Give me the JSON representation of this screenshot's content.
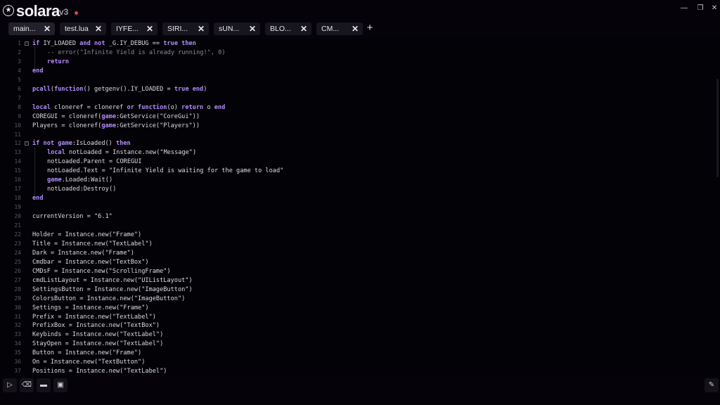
{
  "app": {
    "name": "solara",
    "version": "v3"
  },
  "window_controls": {
    "minimize": "—",
    "maximize": "❐",
    "close": "✕"
  },
  "tabs": [
    {
      "label": "main...",
      "active": true
    },
    {
      "label": "test.lua",
      "active": false
    },
    {
      "label": "IYFE...",
      "active": false
    },
    {
      "label": "SIRI...",
      "active": false
    },
    {
      "label": "sUN...",
      "active": false
    },
    {
      "label": "BLO...",
      "active": false
    },
    {
      "label": "CM...",
      "active": false
    }
  ],
  "tab_add": "+",
  "tab_close": "✕",
  "code": [
    {
      "n": "1",
      "fold": true,
      "indent": 0,
      "t": "<span class=\"kw\">if</span> IY_LOADED <span class=\"kw\">and not</span> _G.IY_DEBUG == <span class=\"kw\">true then</span>"
    },
    {
      "n": "2",
      "indent": 1,
      "t": "<span class=\"com\">-- error(\"Infinite Yield is already running!\", 0)</span>"
    },
    {
      "n": "3",
      "indent": 1,
      "t": "<span class=\"kw\">return</span>"
    },
    {
      "n": "4",
      "indent": 0,
      "t": "<span class=\"kw\">end</span>"
    },
    {
      "n": "5",
      "indent": 0,
      "t": ""
    },
    {
      "n": "6",
      "indent": 0,
      "t": "<span class=\"kw\">pcall</span>(<span class=\"kw\">function</span>() getgenv().IY_LOADED = <span class=\"kw\">true end</span>)"
    },
    {
      "n": "7",
      "indent": 0,
      "t": ""
    },
    {
      "n": "8",
      "indent": 0,
      "t": "<span class=\"kw\">local</span> cloneref = cloneref <span class=\"kw\">or function</span>(o) <span class=\"kw\">return</span> o <span class=\"kw\">end</span>"
    },
    {
      "n": "9",
      "indent": 0,
      "t": "COREGUI = cloneref(<span class=\"kw\">game</span>:GetService(\"CoreGui\"))"
    },
    {
      "n": "10",
      "indent": 0,
      "t": "Players = cloneref(<span class=\"kw\">game</span>:GetService(\"Players\"))"
    },
    {
      "n": "11",
      "indent": 0,
      "t": ""
    },
    {
      "n": "12",
      "fold": true,
      "indent": 0,
      "t": "<span class=\"kw\">if not game</span>:IsLoaded() <span class=\"kw\">then</span>"
    },
    {
      "n": "13",
      "indent": 1,
      "t": "<span class=\"kw\">local</span> notLoaded = Instance.new(\"Message\")"
    },
    {
      "n": "14",
      "indent": 1,
      "t": "notLoaded.Parent = COREGUI"
    },
    {
      "n": "15",
      "indent": 1,
      "t": "notLoaded.Text = \"Infinite Yield is waiting for the game to load\""
    },
    {
      "n": "16",
      "indent": 1,
      "t": "<span class=\"kw\">game</span>.Loaded:Wait()"
    },
    {
      "n": "17",
      "indent": 1,
      "t": "notLoaded:Destroy()"
    },
    {
      "n": "18",
      "indent": 0,
      "t": "<span class=\"kw\">end</span>"
    },
    {
      "n": "19",
      "indent": 0,
      "t": ""
    },
    {
      "n": "20",
      "indent": 0,
      "t": "currentVersion = \"6.1\""
    },
    {
      "n": "21",
      "indent": 0,
      "t": ""
    },
    {
      "n": "22",
      "indent": 0,
      "t": "Holder = Instance.new(\"Frame\")"
    },
    {
      "n": "23",
      "indent": 0,
      "t": "Title = Instance.new(\"TextLabel\")"
    },
    {
      "n": "24",
      "indent": 0,
      "t": "Dark = Instance.new(\"Frame\")"
    },
    {
      "n": "25",
      "indent": 0,
      "t": "Cmdbar = Instance.new(\"TextBox\")"
    },
    {
      "n": "26",
      "indent": 0,
      "t": "CMDsF = Instance.new(\"ScrollingFrame\")"
    },
    {
      "n": "27",
      "indent": 0,
      "t": "cmdListLayout = Instance.new(\"UIListLayout\")"
    },
    {
      "n": "28",
      "indent": 0,
      "t": "SettingsButton = Instance.new(\"ImageButton\")"
    },
    {
      "n": "29",
      "indent": 0,
      "t": "ColorsButton = Instance.new(\"ImageButton\")"
    },
    {
      "n": "30",
      "indent": 0,
      "t": "Settings = Instance.new(\"Frame\")"
    },
    {
      "n": "31",
      "indent": 0,
      "t": "Prefix = Instance.new(\"TextLabel\")"
    },
    {
      "n": "32",
      "indent": 0,
      "t": "PrefixBox = Instance.new(\"TextBox\")"
    },
    {
      "n": "33",
      "indent": 0,
      "t": "Keybinds = Instance.new(\"TextLabel\")"
    },
    {
      "n": "34",
      "indent": 0,
      "t": "StayOpen = Instance.new(\"TextLabel\")"
    },
    {
      "n": "35",
      "indent": 0,
      "t": "Button = Instance.new(\"Frame\")"
    },
    {
      "n": "36",
      "indent": 0,
      "t": "On = Instance.new(\"TextButton\")"
    },
    {
      "n": "37",
      "indent": 0,
      "t": "Positions = Instance.new(\"TextLabel\")"
    }
  ],
  "bottom_buttons": [
    {
      "name": "execute-button",
      "icon": "play-icon",
      "glyph": "▷"
    },
    {
      "name": "clear-button",
      "icon": "eraser-icon",
      "glyph": "⌫"
    },
    {
      "name": "open-file-button",
      "icon": "folder-icon",
      "glyph": "▬"
    },
    {
      "name": "save-file-button",
      "icon": "save-icon",
      "glyph": "▣"
    }
  ],
  "settings_button": {
    "icon": "pin-icon",
    "glyph": "✎"
  },
  "colors": {
    "background": "#050309",
    "keyword": "#b58cff",
    "accent_dot": "#e0415a"
  }
}
